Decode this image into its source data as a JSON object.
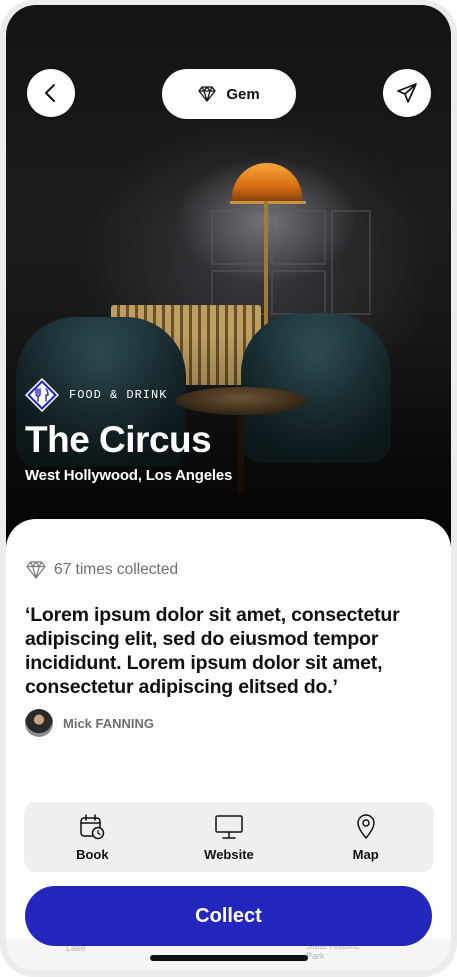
{
  "header": {
    "back_icon": "chevron-left-icon",
    "badge_label": "Gem",
    "badge_icon": "diamond-icon",
    "share_icon": "paper-plane-icon"
  },
  "place": {
    "category": "FOOD & DRINK",
    "category_icon": "fork-knife-icon",
    "name": "The Circus",
    "location": "West Hollywood, Los Angeles"
  },
  "card": {
    "collected_text": "67 times collected",
    "quote": "‘Lorem ipsum dolor sit amet, consectetur adipiscing elit, sed do eiusmod tempor incididunt. Lorem ipsum dolor sit amet, consectetur adipiscing elitsed do.’",
    "author": "Mick FANNING"
  },
  "actions": [
    {
      "label": "Book",
      "icon": "calendar-clock-icon"
    },
    {
      "label": "Website",
      "icon": "monitor-icon"
    },
    {
      "label": "Map",
      "icon": "map-pin-icon"
    }
  ],
  "map_peek": {
    "label_left": "Lake",
    "label_right": "State Historic Park"
  },
  "collect_button": "Collect",
  "colors": {
    "accent": "#2427bd",
    "category_badge": "#2427bd",
    "action_bar_bg": "#efefef"
  }
}
